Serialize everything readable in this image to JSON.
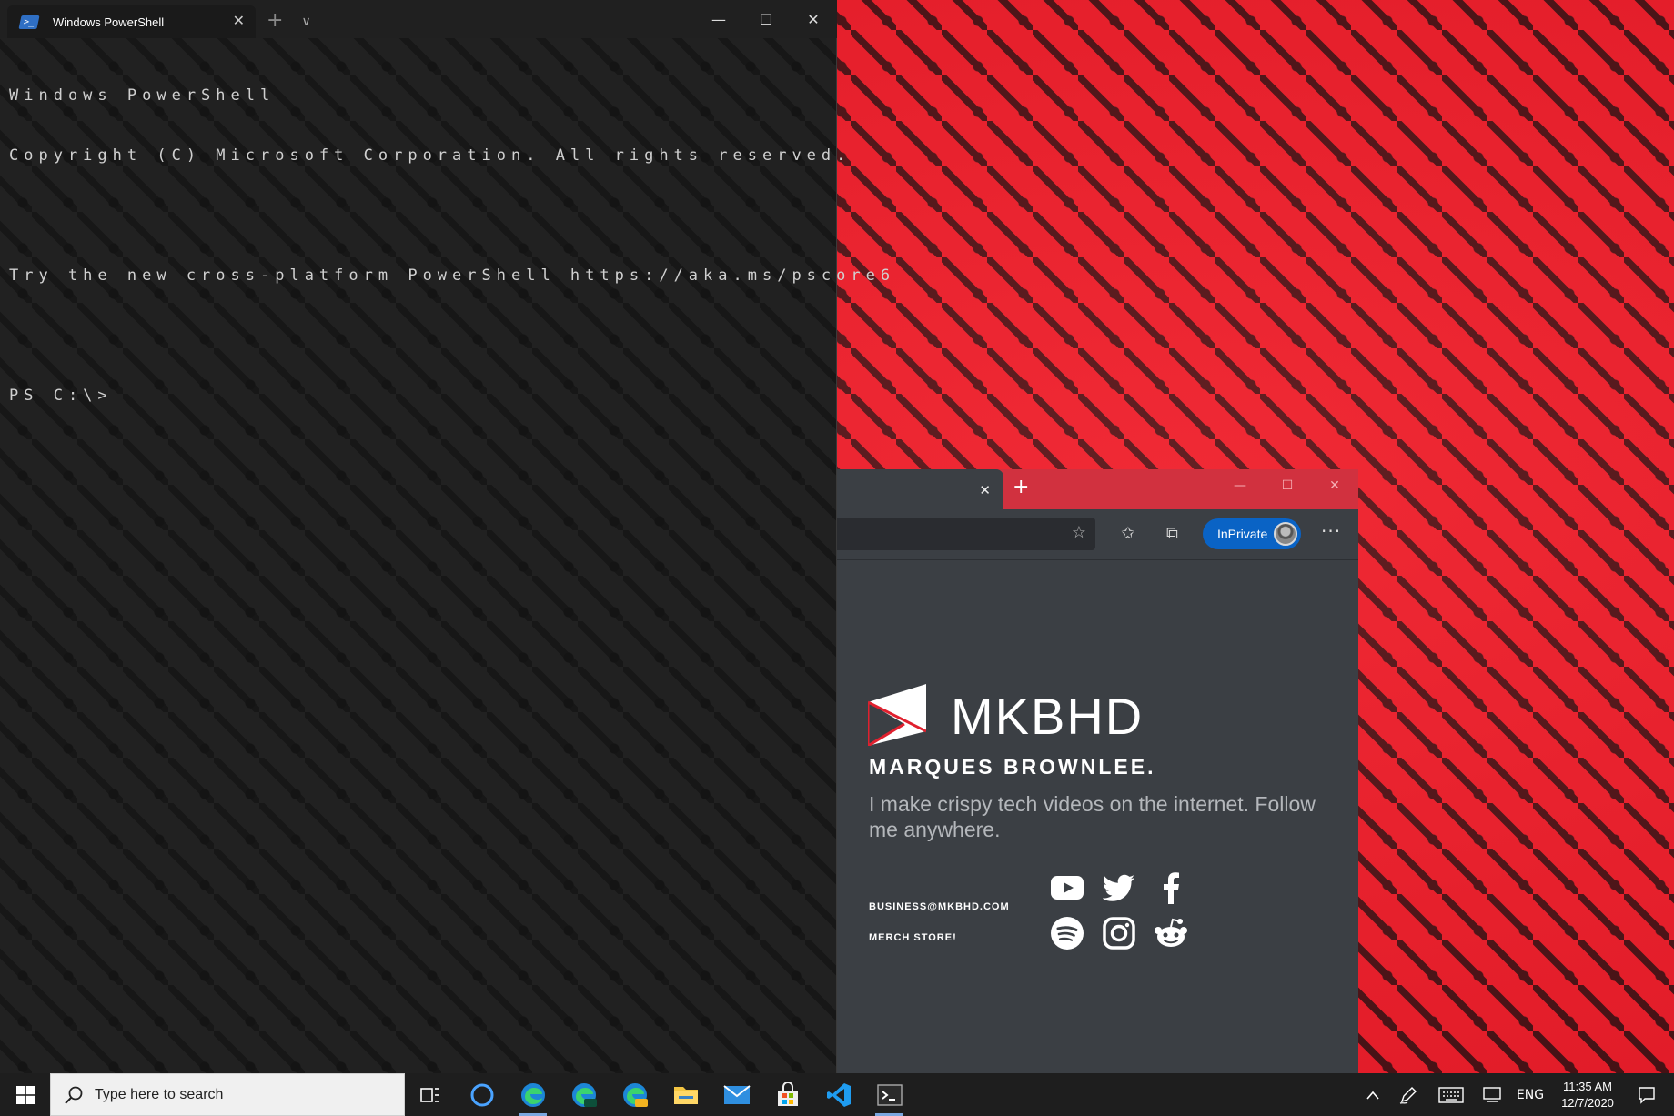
{
  "terminal": {
    "tab_title": "Windows PowerShell",
    "tab_close": "✕",
    "new_tab": "+",
    "dropdown": "∨",
    "minimize": "—",
    "maximize": "☐",
    "close": "✕",
    "lines": [
      "Windows PowerShell",
      "Copyright (C) Microsoft Corporation. All rights reserved.",
      "",
      "Try the new cross-platform PowerShell https://aka.ms/pscore6",
      "",
      "PS C:\\>"
    ]
  },
  "browser": {
    "tab_close": "✕",
    "new_tab": "+",
    "minimize": "—",
    "maximize": "☐",
    "close": "✕",
    "favorite_star": "☆",
    "favorites": "✩",
    "collections": "⧉",
    "inprivate_label": "InPrivate",
    "more": "···",
    "page": {
      "logo_text": "MKBHD",
      "subtitle": "MARQUES BROWNLEE.",
      "tagline": "I make crispy tech videos on the internet. Follow me anywhere.",
      "email": "BUSINESS@MKBHD.COM",
      "merch": "MERCH STORE!",
      "social": [
        "youtube",
        "twitter",
        "facebook",
        "spotify",
        "instagram",
        "reddit"
      ]
    }
  },
  "taskbar": {
    "search_placeholder": "Type here to search",
    "apps": [
      "task-view",
      "cortana",
      "edge",
      "edge-dev",
      "edge-canary",
      "file-explorer",
      "mail",
      "store",
      "vscode",
      "terminal"
    ],
    "tray_language": "ENG",
    "time": "11:35 AM",
    "date": "12/7/2020"
  }
}
